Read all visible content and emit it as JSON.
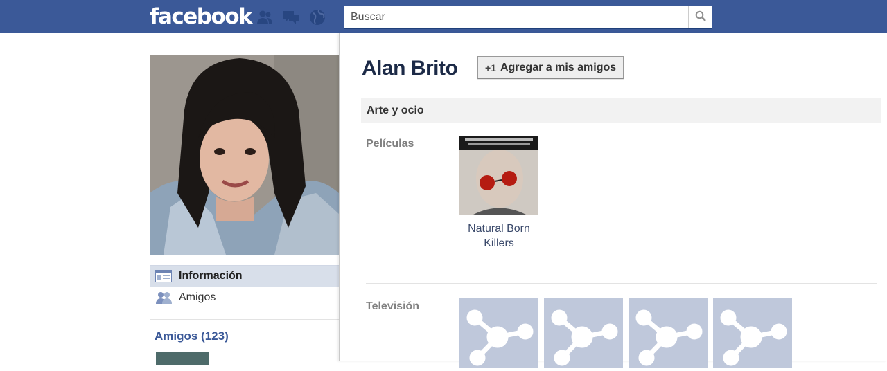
{
  "topbar": {
    "logo": "facebook",
    "search": {
      "placeholder": "Buscar",
      "value": ""
    },
    "icons": [
      "friend-requests-icon",
      "messages-icon",
      "notifications-globe-icon",
      "search-icon"
    ]
  },
  "profile": {
    "name": "Alan Brito",
    "add_friend_label": "Agregar a mis amigos"
  },
  "left_nav": {
    "items": [
      {
        "label": "Información",
        "icon": "info-icon",
        "active": true
      },
      {
        "label": "Amigos",
        "icon": "friends-icon",
        "active": false
      }
    ],
    "friends_header": "Amigos (123)"
  },
  "info": {
    "section_title": "Arte y ocio",
    "movies_label": "Películas",
    "movies": [
      {
        "title": "Natural Born Killers"
      }
    ],
    "tv_label": "Televisión",
    "tv_items_count": 4
  },
  "colors": {
    "brand": "#3b5998",
    "name_text": "#1c2a47",
    "link": "#3b5998",
    "placeholder_tile": "#bfc8db"
  }
}
